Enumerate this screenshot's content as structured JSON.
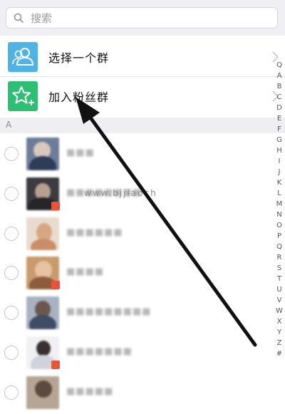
{
  "search": {
    "placeholder": "搜索"
  },
  "actions": [
    {
      "label": "选择一个群",
      "icon": "group-icon",
      "color": "#4fb3e3"
    },
    {
      "label": "加入粉丝群",
      "icon": "star-plus-icon",
      "color": "#2dbf73"
    }
  ],
  "section": {
    "letter": "A"
  },
  "contacts": [
    {
      "name": "■■■",
      "has_badge": false
    },
    {
      "name": "■■■■■■■■",
      "has_badge": true
    },
    {
      "name": "■■■■■■",
      "has_badge": false
    },
    {
      "name": "■■■■",
      "has_badge": true
    },
    {
      "name": "■■■■■■■■■",
      "has_badge": false
    },
    {
      "name": "■■■■■■■",
      "has_badge": true
    },
    {
      "name": "■■■■■",
      "has_badge": false
    }
  ],
  "index": [
    "Q",
    "A",
    "B",
    "C",
    "D",
    "E",
    "F",
    "G",
    "H",
    "I",
    "J",
    "K",
    "L",
    "M",
    "N",
    "O",
    "P",
    "Q",
    "R",
    "S",
    "T",
    "U",
    "V",
    "W",
    "X",
    "Y",
    "Z",
    "#"
  ],
  "watermark": "www.bjjlaoch",
  "colors": {
    "accent_blue": "#4fb3e3",
    "accent_green": "#2dbf73",
    "badge_red": "#e8533b"
  }
}
